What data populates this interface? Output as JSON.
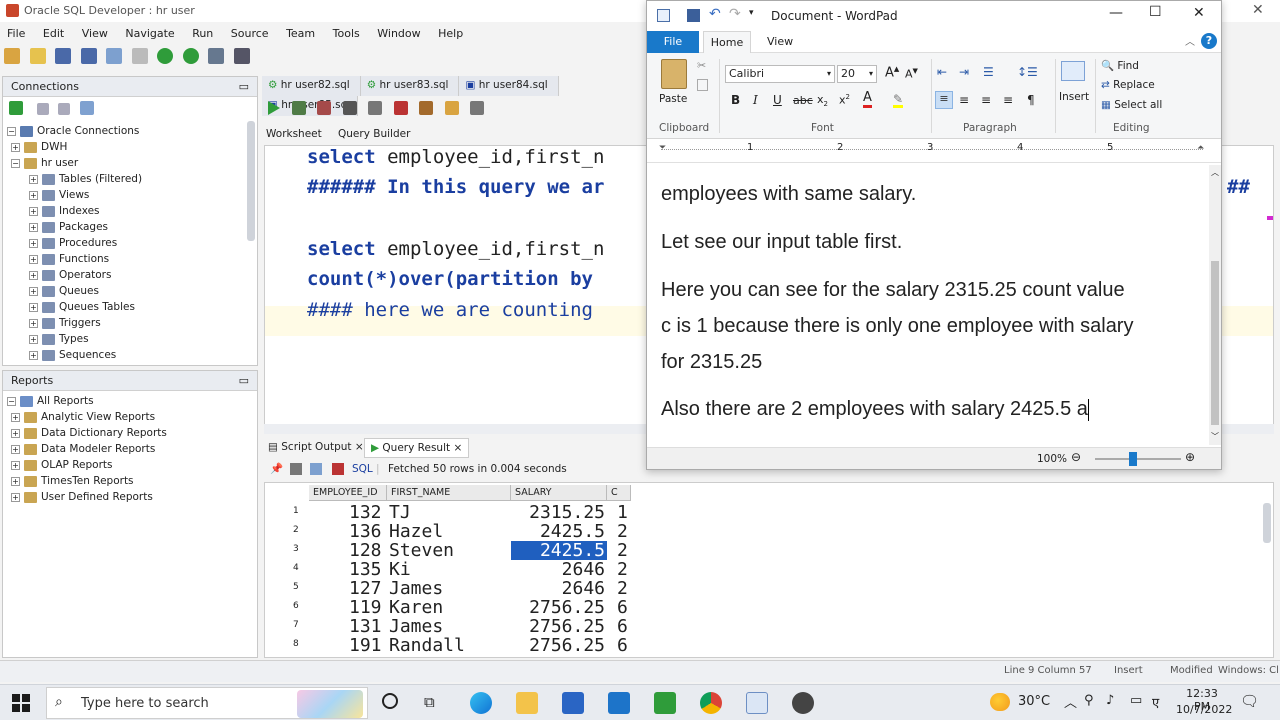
{
  "sqldev": {
    "title": "Oracle SQL Developer : hr user",
    "menu": [
      "File",
      "Edit",
      "View",
      "Navigate",
      "Run",
      "Source",
      "Team",
      "Tools",
      "Window",
      "Help"
    ],
    "connections": {
      "header": "Connections",
      "root": "Oracle Connections",
      "items": [
        "DWH",
        "hr user",
        "Tables (Filtered)",
        "Views",
        "Indexes",
        "Packages",
        "Procedures",
        "Functions",
        "Operators",
        "Queues",
        "Queues Tables",
        "Triggers",
        "Types",
        "Sequences"
      ]
    },
    "reports": {
      "header": "Reports",
      "items": [
        "All Reports",
        "Analytic View Reports",
        "Data Dictionary Reports",
        "Data Modeler Reports",
        "OLAP Reports",
        "TimesTen Reports",
        "User Defined Reports"
      ]
    },
    "editor_tabs": [
      "hr user82.sql",
      "hr user83.sql",
      "hr user84.sql",
      "hr user85.sq"
    ],
    "worksheet_tabs": [
      "Worksheet",
      "Query Builder"
    ],
    "code_lines": [
      {
        "kw": "select",
        "rest": " employee_id,first_n"
      },
      {
        "kw": "###### In this query we ar",
        "rest": ""
      },
      {
        "kw": "",
        "rest": ""
      },
      {
        "kw": "select",
        "rest": " employee_id,first_n"
      },
      {
        "kw": "count",
        "rest": "(*)over(partition by"
      },
      {
        "kw": "####",
        "rest": " here we are counting"
      }
    ],
    "code_right_hash": "##",
    "results_tabs": [
      "Script Output",
      "Query Result"
    ],
    "results_sql": "SQL",
    "fetch_status": "Fetched 50 rows in 0.004 seconds",
    "grid_headers": [
      "EMPLOYEE_ID",
      "FIRST_NAME",
      "SALARY",
      "C"
    ],
    "rows": [
      {
        "n": "1",
        "id": "132",
        "name": "TJ",
        "salary": "2315.25",
        "c": "1"
      },
      {
        "n": "2",
        "id": "136",
        "name": "Hazel",
        "salary": "2425.5",
        "c": "2"
      },
      {
        "n": "3",
        "id": "128",
        "name": "Steven",
        "salary": "2425.5",
        "c": "2"
      },
      {
        "n": "4",
        "id": "135",
        "name": "Ki",
        "salary": "2646",
        "c": "2"
      },
      {
        "n": "5",
        "id": "127",
        "name": "James",
        "salary": "2646",
        "c": "2"
      },
      {
        "n": "6",
        "id": "119",
        "name": "Karen",
        "salary": "2756.25",
        "c": "6"
      },
      {
        "n": "7",
        "id": "131",
        "name": "James",
        "salary": "2756.25",
        "c": "6"
      },
      {
        "n": "8",
        "id": "191",
        "name": "Randall",
        "salary": "2756.25",
        "c": "6"
      }
    ],
    "status": {
      "line_col": "Line 9 Column 57",
      "insert": "Insert",
      "modified": "Modified",
      "windows": "Windows: Cl"
    }
  },
  "wordpad": {
    "title": "Document - WordPad",
    "tabs": [
      "File",
      "Home",
      "View"
    ],
    "paste": "Paste",
    "font_name": "Calibri",
    "font_size": "20",
    "groups": [
      "Clipboard",
      "Font",
      "Paragraph",
      "Editing"
    ],
    "insert": "Insert",
    "editing": [
      "Find",
      "Replace",
      "Select all"
    ],
    "ruler_marks": [
      "1",
      "2",
      "3",
      "4",
      "5"
    ],
    "doc_lines": [
      "employees with same salary.",
      "Let see our input table first.",
      "Here you can see for the salary 2315.25 count value",
      "c is 1 because there is only one employee with salary",
      "for 2315.25",
      "Also there are 2 employees with salary 2425.5 a"
    ],
    "zoom": "100%"
  },
  "taskbar": {
    "search_placeholder": "Type here to search",
    "weather": "30°C",
    "time": "12:33 PM",
    "date": "10/7/2022"
  },
  "colors": {
    "accent_blue": "#1979ca",
    "selection": "#1f5fbf",
    "keyword": "#1a3ea0"
  }
}
